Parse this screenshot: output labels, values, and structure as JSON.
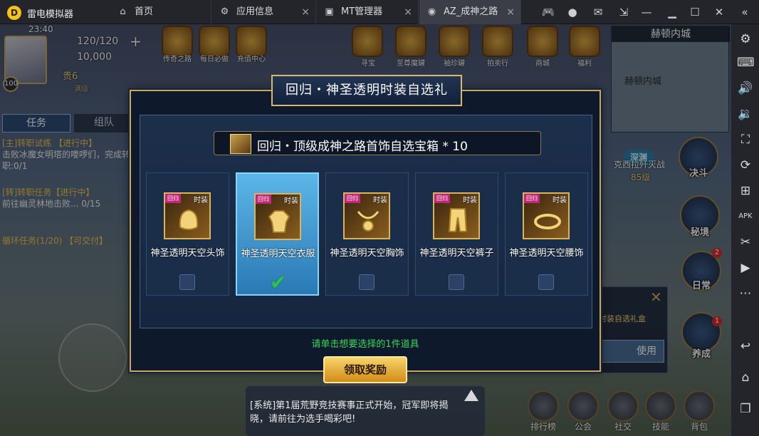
{
  "titlebar": {
    "app_name": "雷电模拟器",
    "tabs": [
      {
        "label": "首页",
        "icon": "home-icon"
      },
      {
        "label": "应用信息",
        "icon": "gear-icon"
      },
      {
        "label": "MT管理器",
        "icon": "android-icon"
      },
      {
        "label": "AZ_成神之路",
        "icon": "game-icon"
      }
    ],
    "close_glyph": "×",
    "window_buttons": [
      "gamepad-icon",
      "account-icon",
      "mail-icon",
      "shrink-icon",
      "minimize-icon",
      "maximize-icon",
      "close-icon",
      "collapse-sidebar-icon"
    ]
  },
  "sidebar": {
    "buttons": [
      "settings-icon",
      "keyboard-icon",
      "volume-up-icon",
      "volume-down-icon",
      "screenshot-icon",
      "rotate-icon",
      "add-app-icon",
      "apk-icon",
      "scissors-icon",
      "record-icon",
      "more-icon",
      "back-icon",
      "home-icon",
      "recent-apps-icon"
    ]
  },
  "hud": {
    "time": "23:40",
    "stamina": "120/120",
    "gold": "10,000",
    "vip": "贵6",
    "vip_sub": "满级",
    "level": "100",
    "top_menu": [
      "传奇之路",
      "每日必做",
      "充值中心",
      "寻宝",
      "至尊魔罐",
      "袖珍罐",
      "拍卖行",
      "商城",
      "福利"
    ],
    "map_title": "赫顿内城",
    "map_label": "赫顿内城",
    "task_tab": "任务",
    "team_tab": "组队",
    "quests": [
      {
        "title": "[主]转职试练 【进行中】",
        "desc": "击败冰魔女明塔的喽啰们，完成转职:0/1"
      },
      {
        "title": "[转]转职任务【进行中】",
        "desc": "前往幽灵林地击败... 0/15"
      },
      {
        "title": "循环任务(1/20) 【可交付】",
        "desc": ""
      }
    ],
    "dungeon_badge": "深渊",
    "dungeon_name": "克西拉歼灭战",
    "dungeon_level": "85级",
    "side_buttons": [
      "决斗",
      "秘境",
      "日常",
      "养成"
    ],
    "side_badges": {
      "日常": "2",
      "养成": "1"
    },
    "bottom_buttons": [
      "排行榜",
      "公会",
      "社交",
      "技能",
      "背包"
    ],
    "behind_panel_text": "时装自选礼盒",
    "behind_panel_btn": "使用"
  },
  "modal": {
    "title": "回归・神圣透明时装自选礼",
    "box_name": "回归・顶级成神之路首饰自选宝箱 * 10",
    "items": [
      {
        "name": "神圣透明天空头饰",
        "tag": "回归",
        "type": "时装",
        "selected": false
      },
      {
        "name": "神圣透明天空衣服",
        "tag": "回归",
        "type": "时装",
        "selected": true
      },
      {
        "name": "神圣透明天空胸饰",
        "tag": "回归",
        "type": "时装",
        "selected": false
      },
      {
        "name": "神圣透明天空裤子",
        "tag": "回归",
        "type": "时装",
        "selected": false
      },
      {
        "name": "神圣透明天空腰饰",
        "tag": "回归",
        "type": "时装",
        "selected": false
      }
    ],
    "hint": "请单击想要选择的1件道具",
    "claim_label": "领取奖励"
  },
  "chat": {
    "message": "[系统]第1届荒野竞技赛事正式开始，冠军即将揭晓，请前往为选手喝彩吧!"
  }
}
